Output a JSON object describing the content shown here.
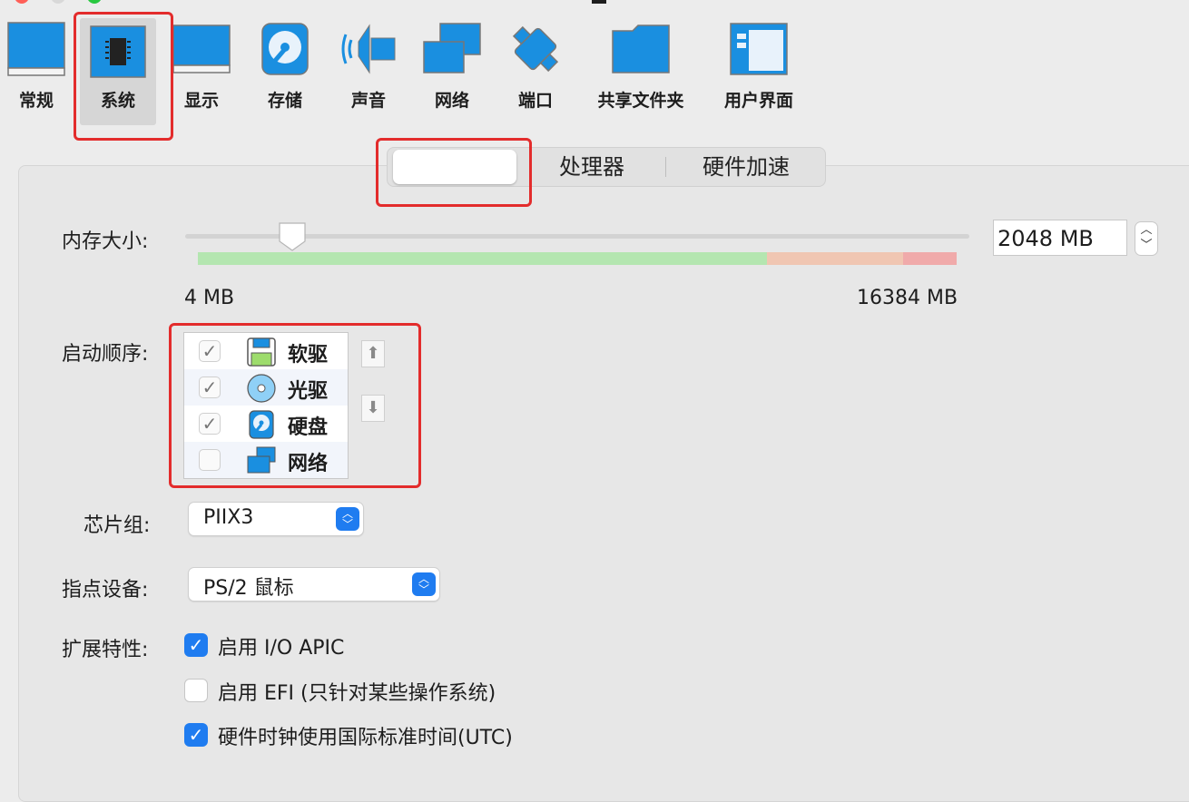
{
  "toolbar": {
    "items": [
      {
        "label": "常规",
        "icon": "general-icon"
      },
      {
        "label": "系统",
        "icon": "chip-icon",
        "selected": true
      },
      {
        "label": "显示",
        "icon": "display-icon"
      },
      {
        "label": "存储",
        "icon": "storage-icon"
      },
      {
        "label": "声音",
        "icon": "speaker-icon"
      },
      {
        "label": "网络",
        "icon": "network-icon"
      },
      {
        "label": "端口",
        "icon": "port-icon"
      },
      {
        "label": "共享文件夹",
        "icon": "folder-icon"
      },
      {
        "label": "用户界面",
        "icon": "ui-window-icon"
      }
    ]
  },
  "tabs": [
    {
      "label": "",
      "active": true
    },
    {
      "label": "处理器"
    },
    {
      "label": "硬件加速"
    }
  ],
  "memory": {
    "label": "内存大小:",
    "value": "2048 MB",
    "min_label": "4 MB",
    "max_label": "16384 MB",
    "slider_value_mb": 2048,
    "slider_min_mb": 4,
    "slider_max_mb": 16384
  },
  "boot_order": {
    "label": "启动顺序:",
    "items": [
      {
        "label": "软驱",
        "checked": true,
        "icon": "floppy-icon"
      },
      {
        "label": "光驱",
        "checked": true,
        "icon": "optical-disc-icon"
      },
      {
        "label": "硬盘",
        "checked": true,
        "icon": "hard-disk-icon"
      },
      {
        "label": "网络",
        "checked": false,
        "icon": "network-icon"
      }
    ],
    "up_icon": "move-up-icon",
    "down_icon": "move-down-icon"
  },
  "chipset": {
    "label": "芯片组:",
    "value": "PIIX3"
  },
  "pointing": {
    "label": "指点设备:",
    "value": "PS/2 鼠标"
  },
  "features": {
    "label": "扩展特性:",
    "items": [
      {
        "label": "启用 I/O APIC",
        "checked": true
      },
      {
        "label": "启用 EFI (只针对某些操作系统)",
        "checked": false
      },
      {
        "label": "硬件时钟使用国际标准时间(UTC)",
        "checked": true
      }
    ]
  },
  "colors": {
    "accent": "#1f7cf0",
    "highlight_red": "#e32c2c",
    "zone_green": "#b4e6b0",
    "zone_orange": "#f0c6b2",
    "zone_red": "#f0aaaa"
  }
}
